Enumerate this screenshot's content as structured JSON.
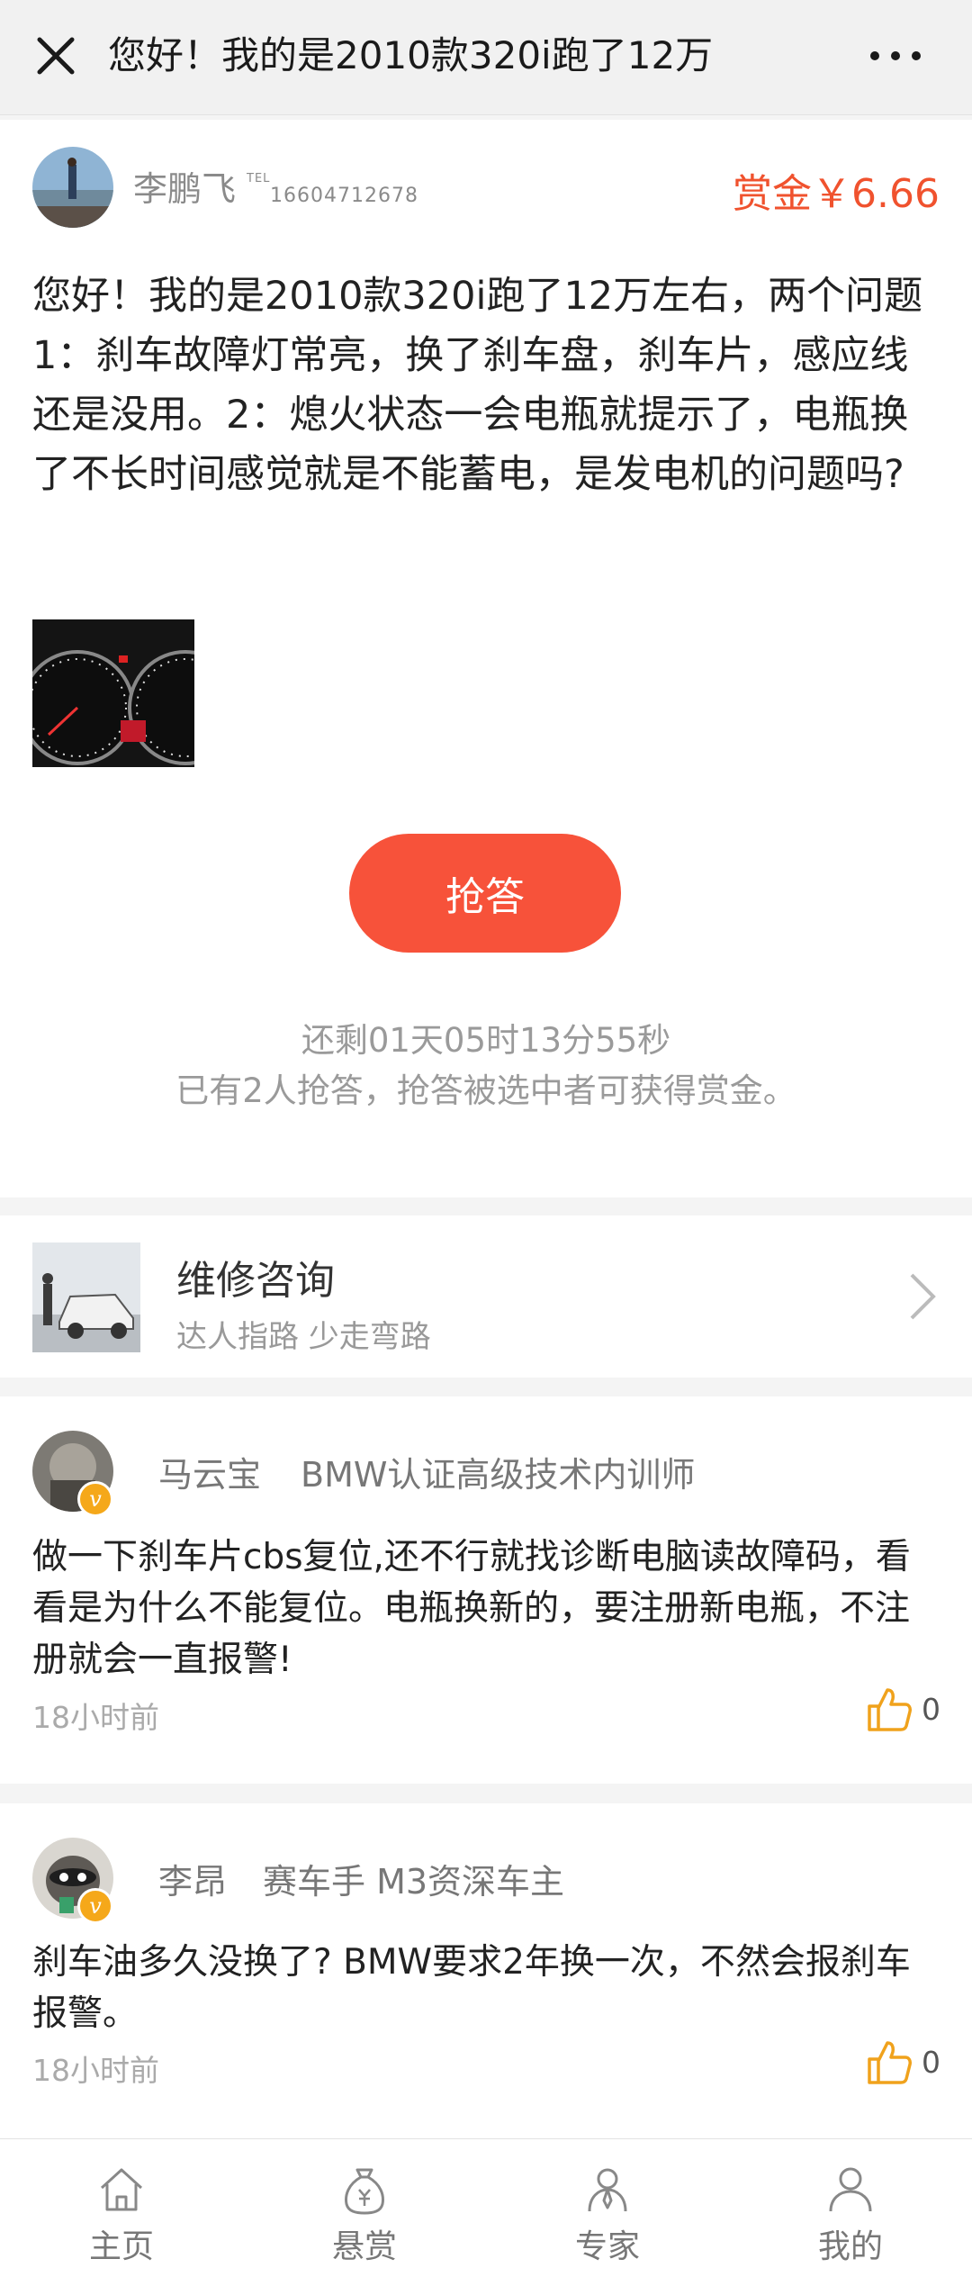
{
  "header": {
    "title": "您好！我的是2010款320i跑了12万"
  },
  "question": {
    "user_name": "李鹏飞",
    "tel_tag": "TEL",
    "phone": "16604712678",
    "reward": "赏金￥6.66",
    "text": "您好！我的是2010款320i跑了12万左右，两个问题1：刹车故障灯常亮，换了刹车盘，刹车片，感应线还是没用。2：熄火状态一会电瓶就提示了，电瓶换了不长时间感觉就是不能蓄电，是发电机的问题吗?",
    "grab_button": "抢答",
    "countdown": "还剩01天05时13分55秒",
    "note": "已有2人抢答，抢答被选中者可获得赏金。"
  },
  "promo": {
    "title": "维修咨询",
    "subtitle": "达人指路 少走弯路"
  },
  "answers": [
    {
      "name": "马云宝",
      "title": "BMW认证高级技术内训师",
      "text": "做一下刹车片cbs复位,还不行就找诊断电脑读故障码，看看是为什么不能复位。电瓶换新的，要注册新电瓶，不注册就会一直报警!",
      "time": "18小时前",
      "likes": "0",
      "badge": "v"
    },
    {
      "name": "李昂",
      "title": "赛车手 M3资深车主",
      "text": "刹车油多久没换了? BMW要求2年换一次，不然会报刹车报警。",
      "time": "18小时前",
      "likes": "0",
      "badge": "v"
    }
  ],
  "tabs": [
    {
      "label": "主页",
      "icon": "home-icon"
    },
    {
      "label": "悬赏",
      "icon": "money-bag-icon"
    },
    {
      "label": "专家",
      "icon": "expert-icon"
    },
    {
      "label": "我的",
      "icon": "user-icon"
    }
  ],
  "colors": {
    "accent": "#f7523a",
    "reward": "#f0522e",
    "badge": "#f5a81a",
    "like": "#f0a21c"
  }
}
